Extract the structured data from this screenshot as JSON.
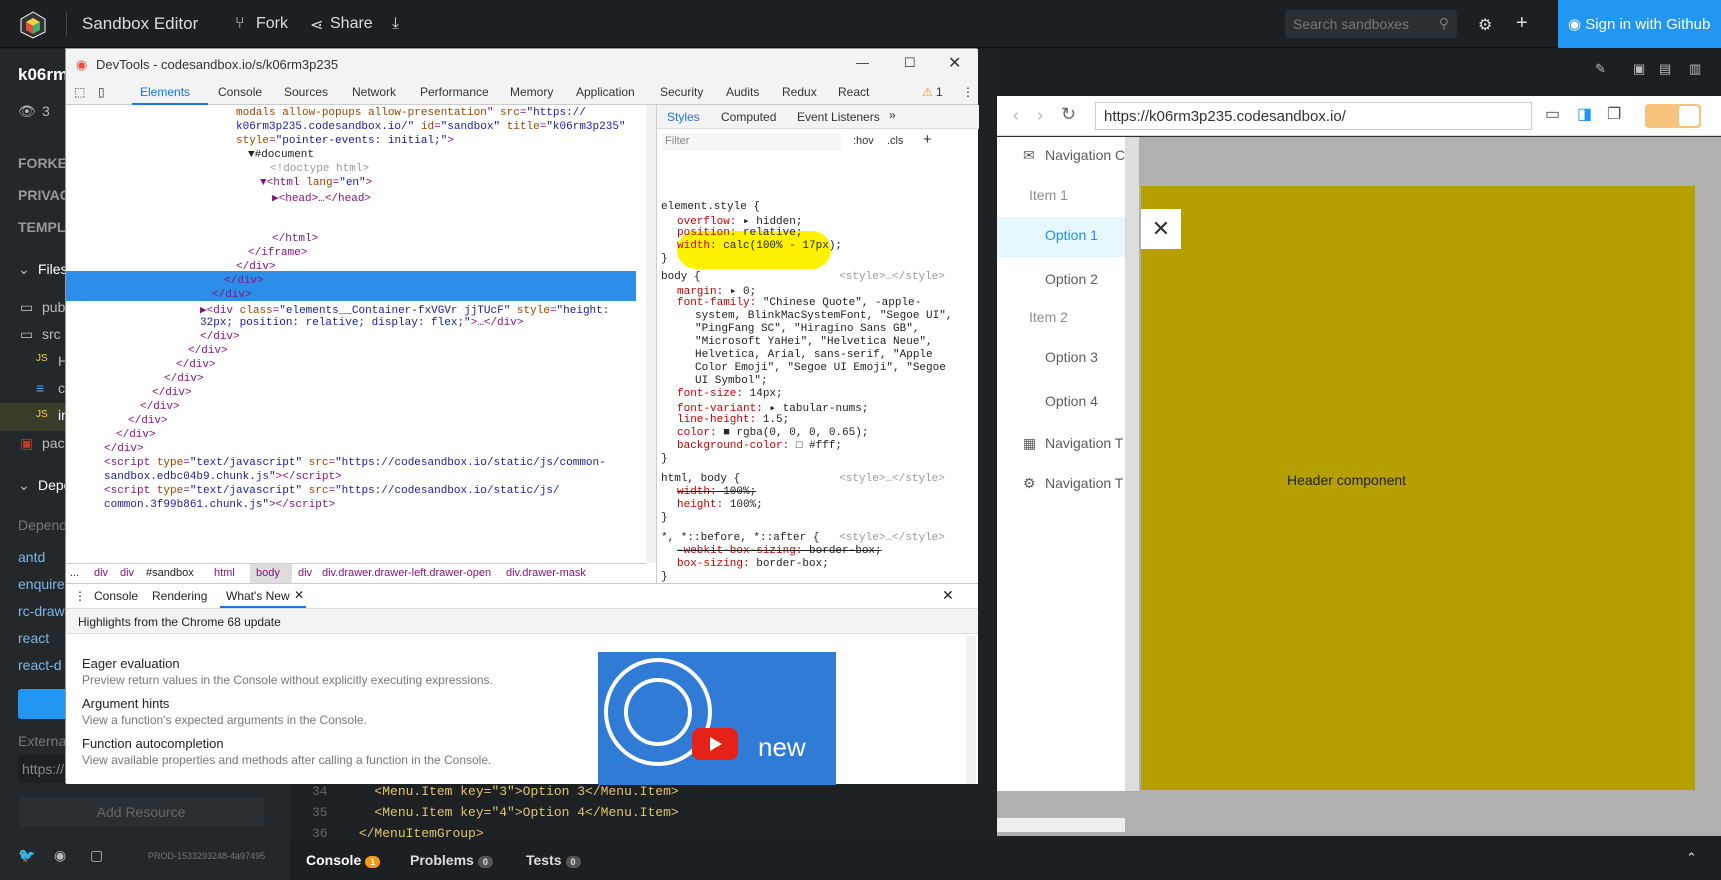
{
  "app": {
    "title": "Sandbox Editor",
    "fork": "Fork",
    "share": "Share",
    "search_placeholder": "Search sandboxes",
    "signin": "Sign in with Github"
  },
  "sidebar": {
    "title": "k06rm",
    "views": "3",
    "forked": "FORKED",
    "privacy": "PRIVAC",
    "template": "TEMPL",
    "files": "Files",
    "items": [
      "pub",
      "src",
      "H",
      "c",
      "in",
      "pac"
    ],
    "deps": "Depe",
    "deps_hint": "Depend",
    "dep_list": [
      "antd",
      "enquire",
      "rc-draw",
      "react",
      "react-d"
    ],
    "external": "Externa",
    "external_val": "https://",
    "add_resource": "Add Resource",
    "build": "PROD-1533293248-4a97495"
  },
  "editor": {
    "lines": [
      {
        "n": "34",
        "code": "<Menu.Item key=\"3\">Option 3</Menu.Item>"
      },
      {
        "n": "35",
        "code": "<Menu.Item key=\"4\">Option 4</Menu.Item>"
      },
      {
        "n": "36",
        "code": "</MenuItemGroup>"
      }
    ]
  },
  "statusbar": {
    "console": "Console",
    "console_count": "1",
    "problems": "Problems",
    "problems_count": "0",
    "tests": "Tests",
    "tests_count": "0"
  },
  "preview": {
    "url": "https://k06rm3p235.codesandbox.io/",
    "menu": [
      "Navigation C",
      "Item 1",
      "Option 1",
      "Option 2",
      "Item 2",
      "Option 3",
      "Option 4",
      "Navigation T",
      "Navigation T"
    ],
    "header": "Header component",
    "close": "✕"
  },
  "devtools": {
    "title": "DevTools - codesandbox.io/s/k06rm3p235",
    "tabs": [
      "Elements",
      "Console",
      "Sources",
      "Network",
      "Performance",
      "Memory",
      "Application",
      "Security",
      "Audits",
      "Redux",
      "React"
    ],
    "warn": "1",
    "style_tabs": [
      "Styles",
      "Computed",
      "Event Listeners"
    ],
    "filter": "Filter",
    "hov": ":hov",
    "cls": ".cls",
    "breadcrumb": [
      "...",
      "div",
      "div",
      "#sandbox",
      "html",
      "body",
      "div",
      "div.drawer.drawer-left.drawer-open",
      "div.drawer-mask"
    ],
    "drawer_tabs": [
      "Console",
      "Rendering",
      "What's New"
    ],
    "highlights": "Highlights from the Chrome 68 update",
    "features": [
      {
        "t": "Eager evaluation",
        "d": "Preview return values in the Console without explicitly executing expressions."
      },
      {
        "t": "Argument hints",
        "d": "View a function's expected arguments in the Console."
      },
      {
        "t": "Function autocompletion",
        "d": "View available properties and methods after calling a function in the Console."
      }
    ],
    "video_text": "new"
  }
}
